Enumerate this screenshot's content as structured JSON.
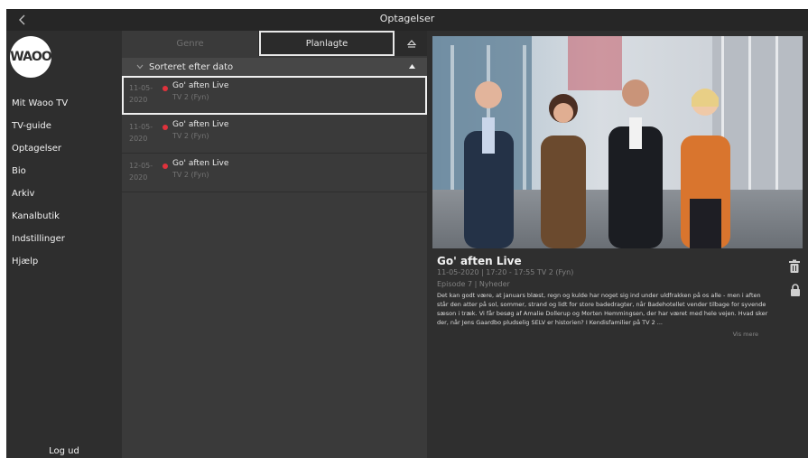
{
  "topbar": {
    "title": "Optagelser",
    "back_icon": "chevron-left-icon"
  },
  "sidebar": {
    "logo_text": "WAOO",
    "items": [
      {
        "label": "Mit Waoo TV"
      },
      {
        "label": "TV-guide"
      },
      {
        "label": "Optagelser"
      },
      {
        "label": "Bio"
      },
      {
        "label": "Arkiv"
      },
      {
        "label": "Kanalbutik"
      },
      {
        "label": "Indstillinger"
      },
      {
        "label": "Hjælp"
      }
    ],
    "logout_label": "Log ud"
  },
  "tabs": {
    "genre_label": "Genre",
    "planned_label": "Planlagte",
    "eject_icon": "eject-icon"
  },
  "sort": {
    "label": "Sorteret efter dato"
  },
  "recordings": [
    {
      "date_day": "11-05-",
      "date_year": "2020",
      "title": "Go' aften Live",
      "channel": "TV 2 (Fyn)",
      "selected": true
    },
    {
      "date_day": "11-05-",
      "date_year": "2020",
      "title": "Go' aften Live",
      "channel": "TV 2 (Fyn)",
      "selected": false
    },
    {
      "date_day": "12-05-",
      "date_year": "2020",
      "title": "Go' aften Live",
      "channel": "TV 2 (Fyn)",
      "selected": false
    }
  ],
  "detail": {
    "title": "Go' aften Live",
    "meta": "11-05-2020 | 17:20 - 17:55  TV 2 (Fyn)",
    "episode": "Episode 7 | Nyheder",
    "description": "Det kan godt være, at januars blæst, regn og kulde har noget sig ind under uldfrakken på os alle - men i aften står den atter på sol, sommer, strand og lidt for store badedragter, når Badehotellet vender tilbage for syvende sæson i træk. Vi får besøg af Amalie Dollerup og Morten Hemmingsen, der har været med hele vejen. Hvad sker der, når Jens Gaardbo pludselig SELV er historien? I Kendisfamilier på TV 2 ...",
    "more_label": "Vis mere",
    "trash_icon": "trash-icon",
    "lock_icon": "lock-icon"
  },
  "colors": {
    "background": "#2b2b2b",
    "sidebar": "#2e2e2e",
    "list_panel": "#3a3a3a",
    "recording_dot": "#e0323c",
    "text": "#e6e6e6",
    "muted": "#747474"
  }
}
